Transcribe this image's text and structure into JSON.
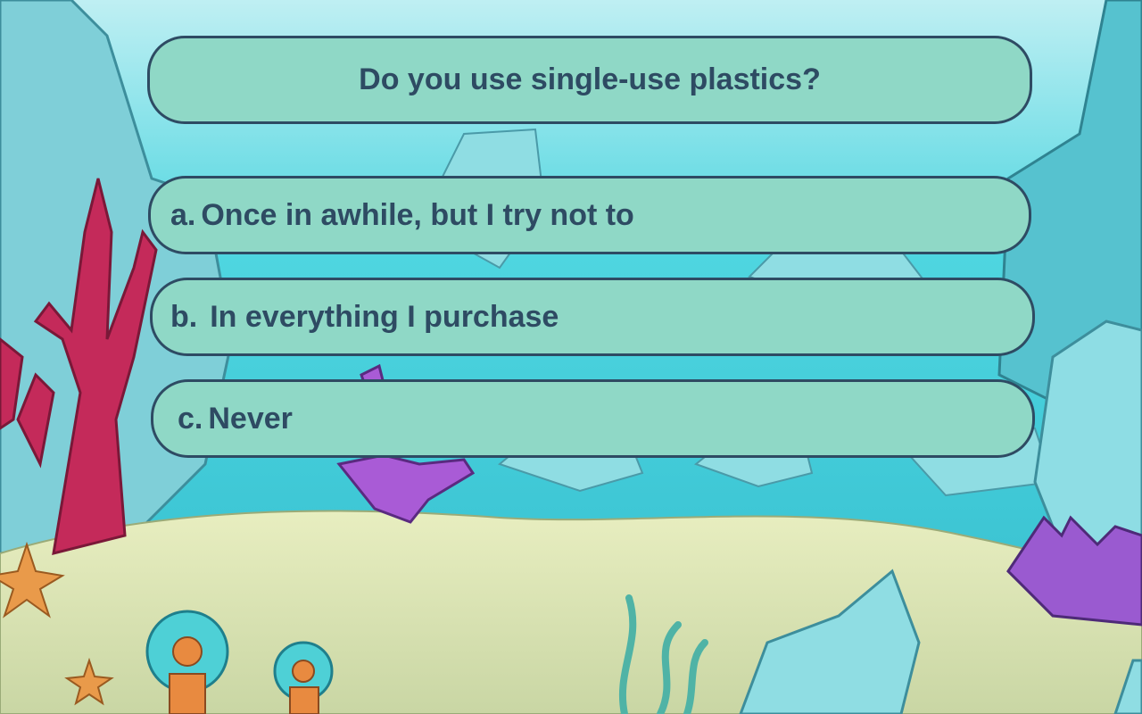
{
  "question": {
    "text": "Do you use single-use plastics?"
  },
  "answers": [
    {
      "letter": "a.",
      "text": "Once in awhile, but I try not to"
    },
    {
      "letter": "b.",
      "text": "In everything I purchase"
    },
    {
      "letter": "c.",
      "text": "Never"
    }
  ],
  "colors": {
    "pill_fill": "#8fd8c6",
    "pill_border": "#2e4b63",
    "text": "#2e4b63",
    "water": "#3fd0dc",
    "sand": "#d8e3b0",
    "coral_red": "#c42a5a",
    "coral_purple": "#9a5ad0"
  }
}
